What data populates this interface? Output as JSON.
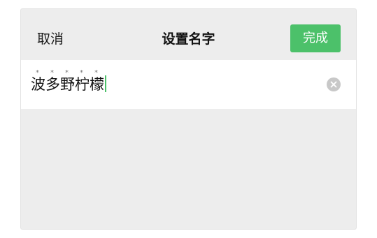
{
  "header": {
    "cancel_label": "取消",
    "title": "设置名字",
    "done_label": "完成"
  },
  "name_input": {
    "value": "波多野柠檬",
    "dots": "*****",
    "clear_icon": "close-circle-icon"
  },
  "colors": {
    "accent": "#4cc16a",
    "background": "#ededed"
  }
}
